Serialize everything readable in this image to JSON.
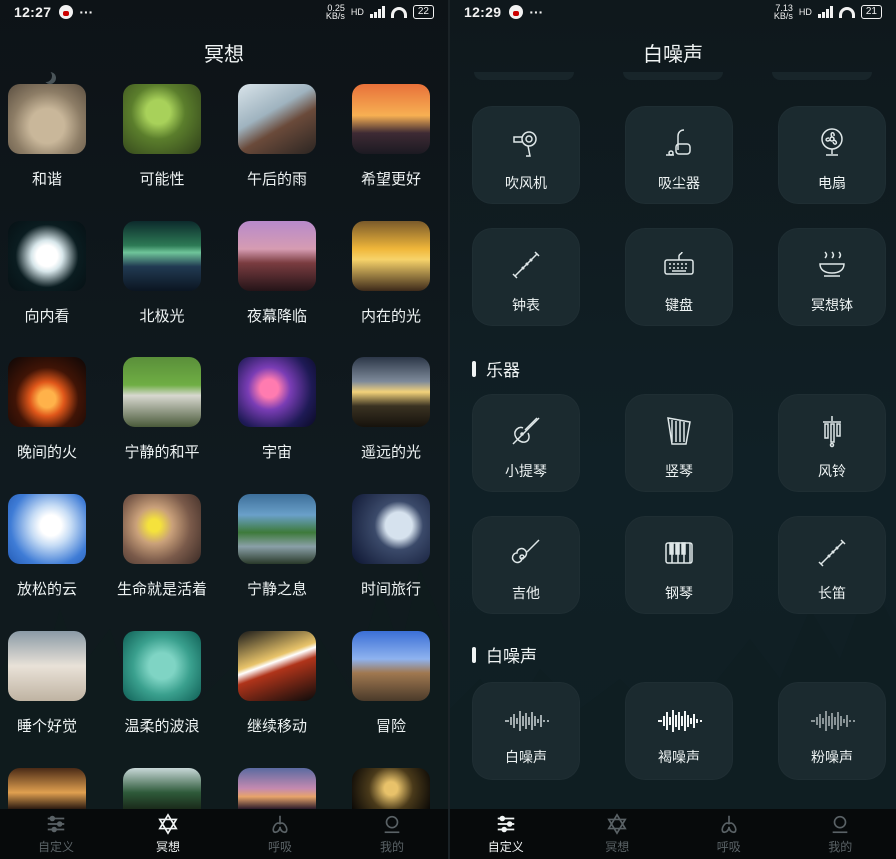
{
  "left": {
    "status": {
      "time": "12:27",
      "dots": "···",
      "netspeed_top": "0.25",
      "netspeed_bottom": "KB/s",
      "hd": "HD",
      "battery": "22"
    },
    "title": "冥想",
    "items": [
      {
        "label": "和谐"
      },
      {
        "label": "可能性"
      },
      {
        "label": "午后的雨"
      },
      {
        "label": "希望更好"
      },
      {
        "label": "向内看"
      },
      {
        "label": "北极光"
      },
      {
        "label": "夜幕降临"
      },
      {
        "label": "内在的光"
      },
      {
        "label": "晚间的火"
      },
      {
        "label": "宁静的和平"
      },
      {
        "label": "宇宙"
      },
      {
        "label": "遥远的光"
      },
      {
        "label": "放松的云"
      },
      {
        "label": "生命就是活着"
      },
      {
        "label": "宁静之息"
      },
      {
        "label": "时间旅行"
      },
      {
        "label": "睡个好觉"
      },
      {
        "label": "温柔的波浪"
      },
      {
        "label": "继续移动"
      },
      {
        "label": "冒险"
      }
    ],
    "nav": [
      {
        "label": "自定义",
        "icon": "sliders-icon"
      },
      {
        "label": "冥想",
        "icon": "star-of-david-icon"
      },
      {
        "label": "呼吸",
        "icon": "lungs-icon"
      },
      {
        "label": "我的",
        "icon": "user-icon"
      }
    ],
    "active_nav": "冥想"
  },
  "right": {
    "status": {
      "time": "12:29",
      "dots": "···",
      "netspeed_top": "7.13",
      "netspeed_bottom": "KB/s",
      "hd": "HD",
      "battery": "21"
    },
    "title": "白噪声",
    "sounds_top": [
      {
        "label": "吹风机",
        "icon": "hair-dryer-icon"
      },
      {
        "label": "吸尘器",
        "icon": "vacuum-icon"
      },
      {
        "label": "电扇",
        "icon": "fan-icon"
      },
      {
        "label": "钟表",
        "icon": "flute-icon"
      },
      {
        "label": "键盘",
        "icon": "keyboard-icon"
      },
      {
        "label": "冥想钵",
        "icon": "singing-bowl-icon"
      }
    ],
    "section_instruments": "乐器",
    "instruments": [
      {
        "label": "小提琴",
        "icon": "violin-icon"
      },
      {
        "label": "竖琴",
        "icon": "harp-icon"
      },
      {
        "label": "风铃",
        "icon": "wind-chime-icon"
      },
      {
        "label": "吉他",
        "icon": "guitar-icon"
      },
      {
        "label": "钢琴",
        "icon": "piano-icon"
      },
      {
        "label": "长笛",
        "icon": "flute-icon"
      }
    ],
    "section_noise": "白噪声",
    "noises": [
      {
        "label": "白噪声",
        "icon": "waveform-icon"
      },
      {
        "label": "褐噪声",
        "icon": "waveform-icon"
      },
      {
        "label": "粉噪声",
        "icon": "waveform-icon"
      }
    ],
    "nav": [
      {
        "label": "自定义",
        "icon": "sliders-icon"
      },
      {
        "label": "冥想",
        "icon": "star-of-david-icon"
      },
      {
        "label": "呼吸",
        "icon": "lungs-icon"
      },
      {
        "label": "我的",
        "icon": "user-icon"
      }
    ],
    "active_nav": "自定义"
  }
}
